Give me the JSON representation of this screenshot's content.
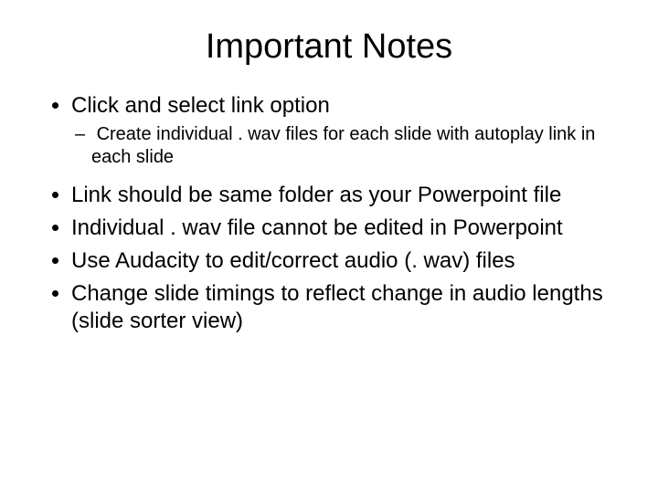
{
  "title": "Important Notes",
  "bullets": {
    "b1": "Click and select link option",
    "b1_sub1": "Create individual . wav files for each slide with autoplay link in each slide",
    "b2": "Link should be same folder as your Powerpoint file",
    "b3": "Individual . wav file cannot be edited in Powerpoint",
    "b4": "Use Audacity to edit/correct audio (. wav) files",
    "b5": "Change slide timings to reflect change in audio lengths  (slide sorter view)"
  }
}
